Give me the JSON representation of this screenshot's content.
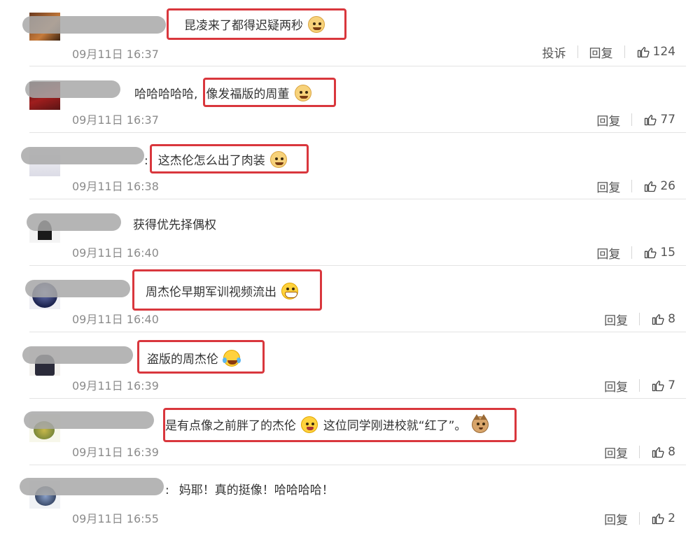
{
  "actions": {
    "report": "投诉",
    "reply": "回复"
  },
  "colors": {
    "highlight_box": "#d9373d",
    "text": "#333333",
    "meta": "#8b8b8b"
  },
  "comments": [
    {
      "text_parts": [
        "昆凌来了都得迟疑两秒"
      ],
      "emoji": [
        "doge-face-icon"
      ],
      "time": "09月11日 16:37",
      "likes": "124",
      "has_report": true
    },
    {
      "prefix": "哈哈哈哈哈,",
      "text_parts": [
        "像发福版的周董"
      ],
      "emoji": [
        "doge-face-icon"
      ],
      "time": "09月11日 16:37",
      "likes": "77"
    },
    {
      "prefix": ":",
      "text_parts": [
        "这杰伦怎么出了肉装"
      ],
      "emoji": [
        "doge-face-icon"
      ],
      "time": "09月11日 16:38",
      "likes": "26"
    },
    {
      "text_parts": [
        "获得优先择偶权"
      ],
      "time": "09月11日 16:40",
      "likes": "15"
    },
    {
      "text_parts": [
        "周杰伦早期军训视频流出"
      ],
      "emoji": [
        "grin-face-icon"
      ],
      "time": "09月11日 16:40",
      "likes": "8"
    },
    {
      "text_parts": [
        "盗版的周杰伦"
      ],
      "emoji": [
        "laugh-tears-icon"
      ],
      "time": "09月11日 16:39",
      "likes": "7"
    },
    {
      "text_parts": [
        "是有点像之前胖了的杰伦",
        "这位同学刚进校就“红了”。"
      ],
      "emoji": [
        "blush-face-icon",
        "cat-face-icon"
      ],
      "time": "09月11日 16:39",
      "likes": "8"
    },
    {
      "prefix": ":",
      "text_parts": [
        "妈耶！真的挺像！哈哈哈哈！"
      ],
      "time": "09月11日 16:55",
      "likes": "2"
    }
  ]
}
